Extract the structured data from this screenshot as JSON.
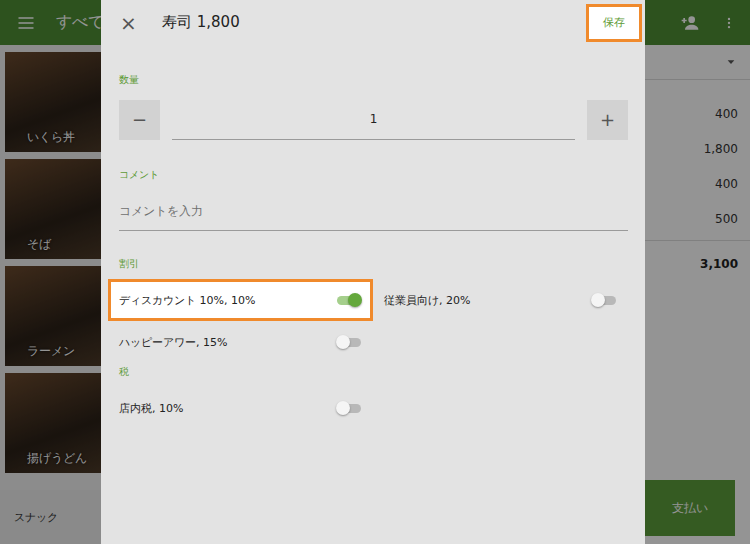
{
  "background": {
    "header_title": "すべて",
    "categories": [
      {
        "label": "いくら丼"
      },
      {
        "label": "そば"
      },
      {
        "label": "ラーメン"
      },
      {
        "label": "揚げうどん"
      }
    ],
    "bottom_tab": "スナック",
    "order_lines": [
      "400",
      "1,800",
      "400",
      "500"
    ],
    "total": "3,100",
    "pay_button": "支払い"
  },
  "dialog": {
    "close": "×",
    "title": "寿司 1,800",
    "save": {
      "label": "保存",
      "highlighted": true
    },
    "quantity": {
      "label": "数量",
      "minus": "−",
      "value": "1",
      "plus": "+"
    },
    "comment": {
      "label": "コメント",
      "placeholder": "コメントを入力"
    },
    "discounts": {
      "label": "割引",
      "items": [
        {
          "label": "ディスカウント 10%, 10%",
          "on": true,
          "highlighted": true
        },
        {
          "label": "従業員向け, 20%",
          "on": false,
          "highlighted": false
        },
        {
          "label": "ハッピーアワー, 15%",
          "on": false,
          "highlighted": false
        }
      ]
    },
    "taxes": {
      "label": "税",
      "items": [
        {
          "label": "店内税, 10%",
          "on": false,
          "highlighted": false
        }
      ]
    }
  }
}
